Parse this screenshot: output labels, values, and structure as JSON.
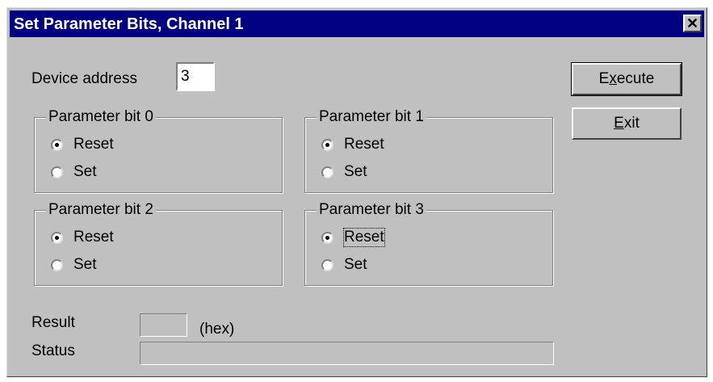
{
  "window": {
    "title": "Set Parameter Bits, Channel 1",
    "close_glyph": "✕",
    "close_icon": "close-icon"
  },
  "device_address": {
    "label": "Device address",
    "value": "3"
  },
  "groups": [
    {
      "title": "Parameter bit 0",
      "options": [
        "Reset",
        "Set"
      ],
      "selected": "Reset"
    },
    {
      "title": "Parameter bit 1",
      "options": [
        "Reset",
        "Set"
      ],
      "selected": "Reset"
    },
    {
      "title": "Parameter bit 2",
      "options": [
        "Reset",
        "Set"
      ],
      "selected": "Reset"
    },
    {
      "title": "Parameter bit 3",
      "options": [
        "Reset",
        "Set"
      ],
      "selected": "Reset",
      "focused": "Reset"
    }
  ],
  "buttons": {
    "execute": {
      "pre": "E",
      "accel": "x",
      "post": "ecute"
    },
    "exit": {
      "pre": "",
      "accel": "E",
      "post": "xit"
    }
  },
  "result": {
    "label": "Result",
    "value": "",
    "unit": "(hex)"
  },
  "status": {
    "label": "Status",
    "value": ""
  }
}
